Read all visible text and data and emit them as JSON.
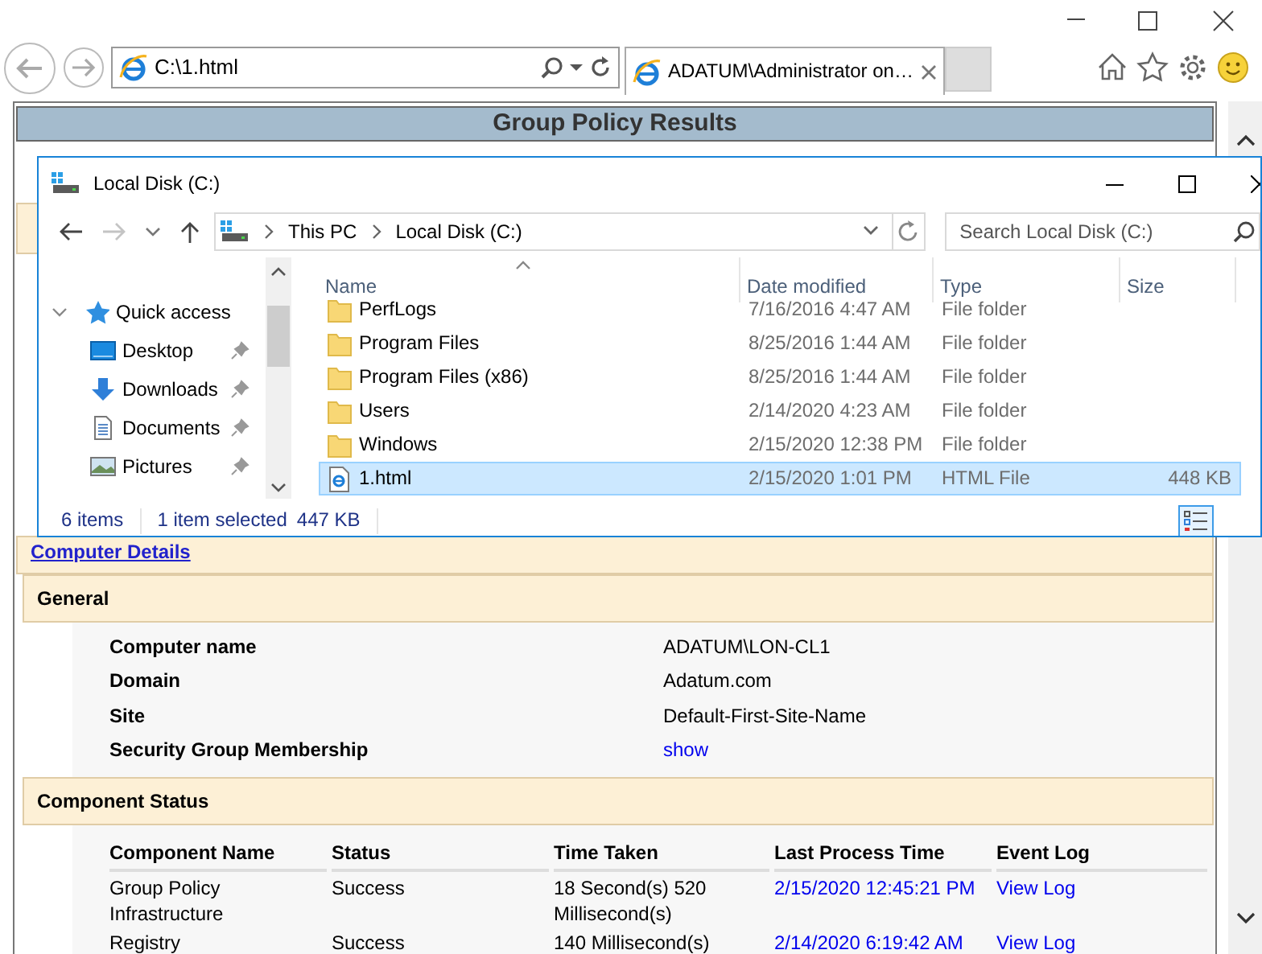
{
  "browser": {
    "address": "C:\\1.html",
    "tabs": [
      {
        "title": "ADATUM\\Administrator on…",
        "selected": true
      }
    ]
  },
  "page": {
    "title": "Group Policy Results",
    "computer_details": {
      "heading": "Computer Details"
    },
    "general": {
      "heading": "General",
      "rows": [
        {
          "label": "Computer name",
          "value": "ADATUM\\LON-CL1",
          "kind": "text"
        },
        {
          "label": "Domain",
          "value": "Adatum.com",
          "kind": "text"
        },
        {
          "label": "Site",
          "value": "Default-First-Site-Name",
          "kind": "text"
        },
        {
          "label": "Security Group Membership",
          "value": "show",
          "kind": "link"
        }
      ]
    },
    "component_status": {
      "heading": "Component Status",
      "columns": [
        "Component Name",
        "Status",
        "Time Taken",
        "Last Process Time",
        "Event Log"
      ],
      "rows": [
        {
          "component": "Group Policy Infrastructure",
          "status": "Success",
          "time_taken": "18 Second(s) 520 Millisecond(s)",
          "last_process_time": "2/15/2020 12:45:21 PM",
          "event_log": "View Log"
        },
        {
          "component": "Registry",
          "status": "Success",
          "time_taken": "140 Millisecond(s)",
          "last_process_time": "2/14/2020 6:19:42 AM",
          "event_log": "View Log"
        }
      ]
    }
  },
  "explorer": {
    "title": "Local Disk (C:)",
    "breadcrumb": [
      "This PC",
      "Local Disk (C:)"
    ],
    "search": {
      "placeholder": "Search Local Disk (C:)"
    },
    "nav": [
      {
        "label": "Quick access",
        "kind": "quick",
        "pinned": false
      },
      {
        "label": "Desktop",
        "kind": "desktop",
        "pinned": true
      },
      {
        "label": "Downloads",
        "kind": "downloads",
        "pinned": true
      },
      {
        "label": "Documents",
        "kind": "documents",
        "pinned": true
      },
      {
        "label": "Pictures",
        "kind": "pictures",
        "pinned": true
      }
    ],
    "columns": [
      "Name",
      "Date modified",
      "Type",
      "Size"
    ],
    "files": [
      {
        "name": "PerfLogs",
        "date": "7/16/2016 4:47 AM",
        "type": "File folder",
        "kind": "folder",
        "selected": false
      },
      {
        "name": "Program Files",
        "date": "8/25/2016 1:44 AM",
        "type": "File folder",
        "kind": "folder",
        "selected": false
      },
      {
        "name": "Program Files (x86)",
        "date": "8/25/2016 1:44 AM",
        "type": "File folder",
        "kind": "folder",
        "selected": false
      },
      {
        "name": "Users",
        "date": "2/14/2020 4:23 AM",
        "type": "File folder",
        "kind": "folder",
        "selected": false
      },
      {
        "name": "Windows",
        "date": "2/15/2020 12:38 PM",
        "type": "File folder",
        "kind": "folder",
        "selected": false
      },
      {
        "name": "1.html",
        "date": "2/15/2020 1:01 PM",
        "type": "HTML File",
        "size": "448 KB",
        "kind": "html",
        "selected": true
      }
    ],
    "status": {
      "items": "6 items",
      "selection": "1 item selected",
      "selection_size": "447 KB"
    }
  }
}
